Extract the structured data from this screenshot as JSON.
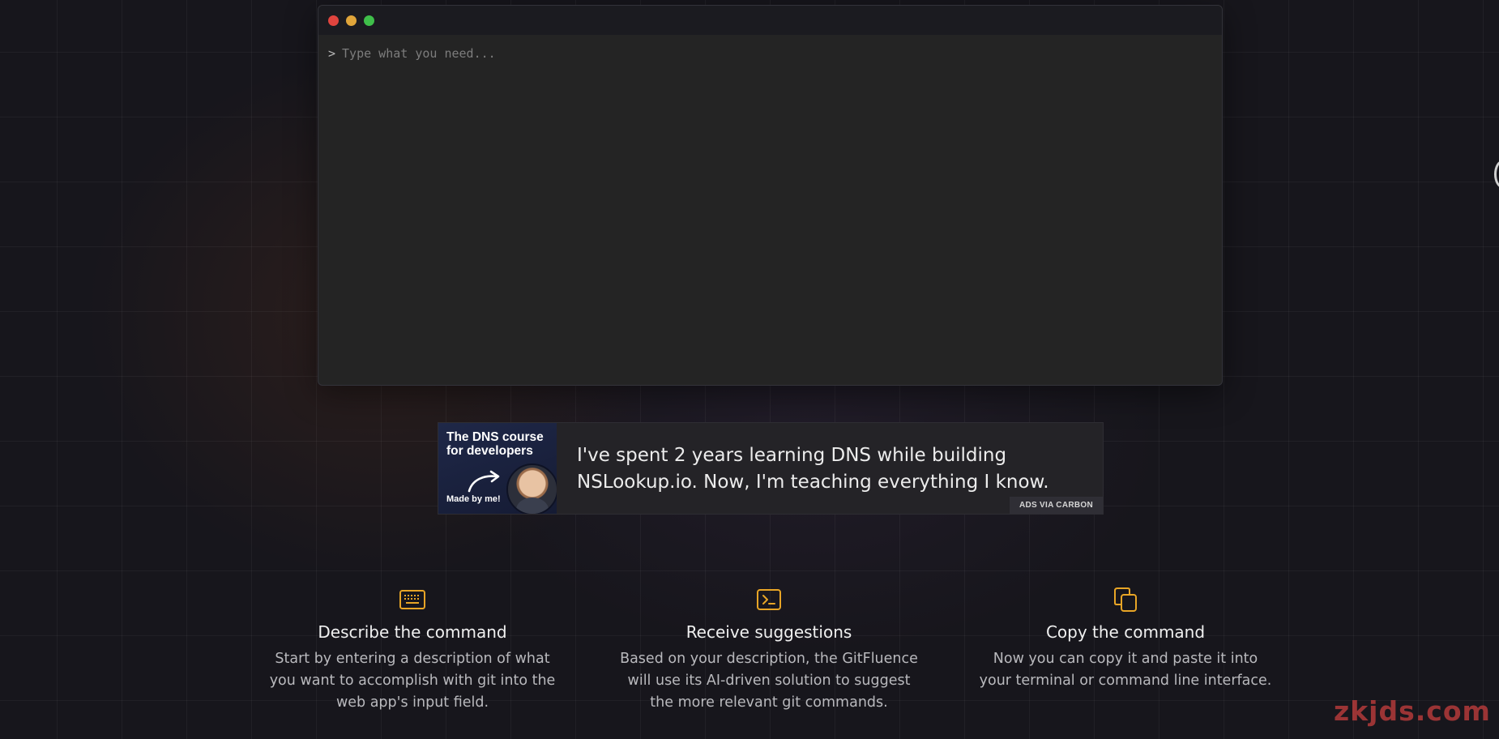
{
  "colors": {
    "background": "#17161c",
    "terminal_bg": "#242424",
    "titlebar_bg": "#1b1b20",
    "accent": "#e8a526",
    "dot_close": "#e0443e",
    "dot_minimize": "#e0a53a",
    "dot_maximize": "#3fbf4a"
  },
  "terminal": {
    "prompt_symbol": ">",
    "input": {
      "value": "",
      "placeholder": "Type what you need..."
    },
    "window_controls": [
      {
        "name": "close",
        "color": "#e0443e"
      },
      {
        "name": "minimize",
        "color": "#e0a53a"
      },
      {
        "name": "maximize",
        "color": "#3fbf4a"
      }
    ]
  },
  "ad": {
    "image_title": "The DNS course for developers",
    "image_caption": "Made by me!",
    "text": "I've spent 2 years learning DNS while building NSLookup.io. Now, I'm teaching everything I know.",
    "badge": "ADS VIA CARBON"
  },
  "features": [
    {
      "icon": "keyboard-icon",
      "title": "Describe the command",
      "description": "Start by entering a description of what you want to accomplish with git into the web app's input field."
    },
    {
      "icon": "terminal-icon",
      "title": "Receive suggestions",
      "description": "Based on your description, the GitFluence will use its AI-driven solution to suggest the more relevant git commands."
    },
    {
      "icon": "copy-icon",
      "title": "Copy the command",
      "description": "Now you can copy it and paste it into your terminal or command line interface."
    }
  ],
  "watermark": "zkjds.com"
}
